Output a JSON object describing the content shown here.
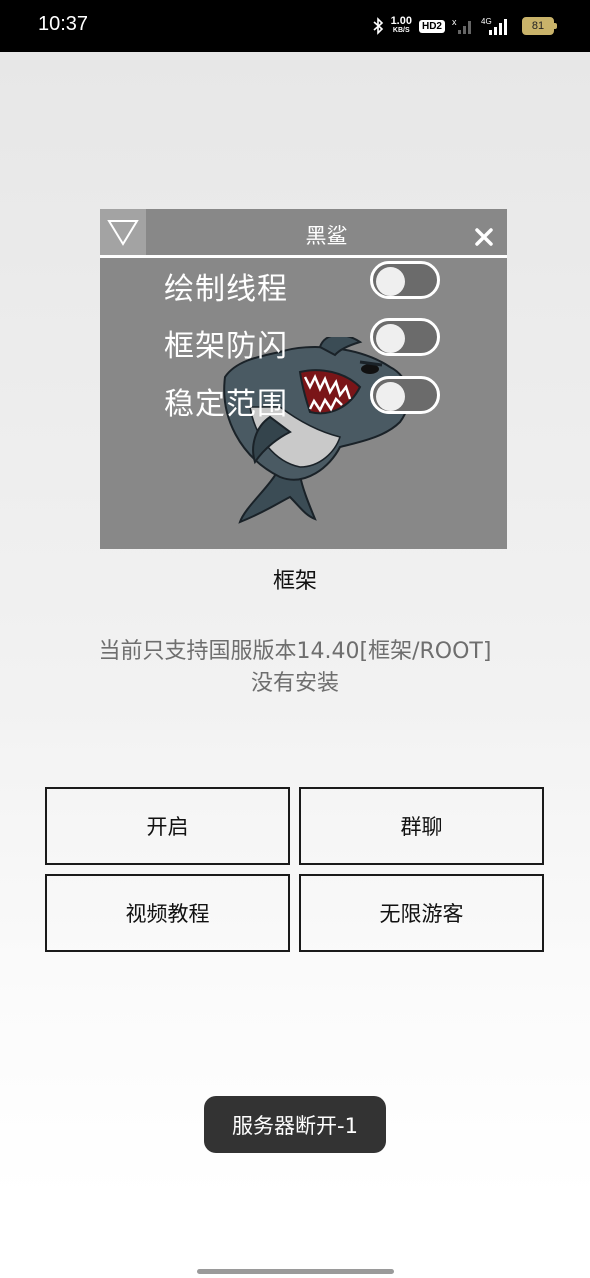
{
  "status_bar": {
    "time": "10:37",
    "net_speed_value": "1.00",
    "net_speed_unit": "KB/S",
    "hd_badge": "HD2",
    "signal_label": "4G",
    "battery": "81",
    "icons": [
      "bluetooth-icon",
      "wifi-off-icon",
      "signal-icon",
      "battery-icon"
    ]
  },
  "panel": {
    "title": "黑鲨",
    "options": [
      {
        "label": "绘制线程",
        "enabled": false
      },
      {
        "label": "框架防闪",
        "enabled": false
      },
      {
        "label": "稳定范围",
        "enabled": false
      }
    ]
  },
  "frame_label": "框架",
  "info": {
    "line1": "当前只支持国服版本14.40[框架/ROOT]",
    "line2": "没有安装"
  },
  "buttons": {
    "start": "开启",
    "group_chat": "群聊",
    "video_tutorial": "视频教程",
    "unlimited_guest": "无限游客"
  },
  "toast": "服务器断开-1",
  "colors": {
    "panel_bg": "#888888",
    "toast_bg": "#333333",
    "status_bar_bg": "#000000"
  }
}
